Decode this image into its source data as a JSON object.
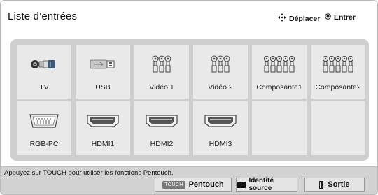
{
  "header": {
    "title": "Liste d’entrées",
    "move_label": "Déplacer",
    "enter_label": "Entrer"
  },
  "inputs": [
    {
      "label": "TV",
      "icon": "tv-antenna-icon"
    },
    {
      "label": "USB",
      "icon": "usb-icon"
    },
    {
      "label": "Vidéo 1",
      "icon": "rca-video-icon"
    },
    {
      "label": "Vidéo 2",
      "icon": "rca-video-icon"
    },
    {
      "label": "Composante1",
      "icon": "component-icon"
    },
    {
      "label": "Composante2",
      "icon": "component-icon"
    },
    {
      "label": "RGB-PC",
      "icon": "vga-icon"
    },
    {
      "label": "HDMI1",
      "icon": "hdmi-icon"
    },
    {
      "label": "HDMI2",
      "icon": "hdmi-icon"
    },
    {
      "label": "HDMI3",
      "icon": "hdmi-icon"
    },
    {
      "label": "",
      "icon": ""
    },
    {
      "label": "",
      "icon": ""
    }
  ],
  "footer": {
    "message": "Appuyez sur TOUCH pour utiliser les fonctions Pentouch.",
    "touch_badge": "TOUCH",
    "pentouch_label": "Pentouch",
    "source_label": "Identité source",
    "exit_label": "Sortie"
  }
}
